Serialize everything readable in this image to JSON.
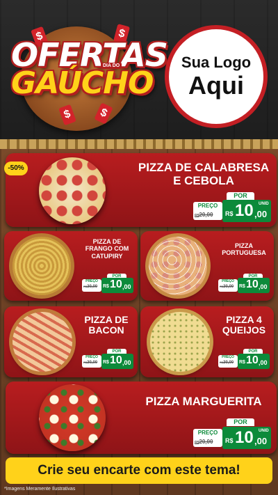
{
  "header": {
    "badge_word1": "OFERTAS",
    "badge_word2": "GAÚCHO",
    "badge_small": "DIA DO",
    "coin_symbol": "$",
    "logo_line1": "Sua Logo",
    "logo_line2": "Aqui"
  },
  "discount_badge": "-50%",
  "labels": {
    "por": "POR",
    "preco": "PREÇO",
    "unid": "UNID",
    "rs": "R$",
    "rs_small": "R$"
  },
  "products": [
    {
      "name_line1": "PIZZA DE CALABRESA",
      "name_line2": "E CEBOLA",
      "old_price": "20,00",
      "price_int": "10",
      "price_dec": ",00",
      "image": "calabresa-pizza"
    },
    {
      "name_line1": "PIZZA DE",
      "name_line2": "FRANGO COM",
      "name_line3": "CATUPIRY",
      "old_price": "20,00",
      "price_int": "10",
      "price_dec": ",00",
      "image": "frango-pizza"
    },
    {
      "name_line1": "PIZZA",
      "name_line2": "PORTUGUESA",
      "old_price": "20,00",
      "price_int": "10",
      "price_dec": ",00",
      "image": "portuguesa-pizza"
    },
    {
      "name_line1": "PIZZA DE",
      "name_line2": "BACON",
      "old_price": "20,00",
      "price_int": "10",
      "price_dec": ",00",
      "image": "bacon-pizza"
    },
    {
      "name_line1": "PIZZA 4",
      "name_line2": "QUEIJOS",
      "old_price": "20,00",
      "price_int": "10",
      "price_dec": ",00",
      "image": "queijos-pizza"
    },
    {
      "name_line1": "PIZZA MARGUERITA",
      "old_price": "20,00",
      "price_int": "10",
      "price_dec": ",00",
      "image": "marguerita-pizza"
    }
  ],
  "cta": "Crie seu encarte com este tema!",
  "disclaimer": "*Imagens Meramente Ilustrativas",
  "colors": {
    "card_red": "#b81d1f",
    "price_green": "#0c8a3a",
    "accent_yellow": "#ffd21a"
  }
}
